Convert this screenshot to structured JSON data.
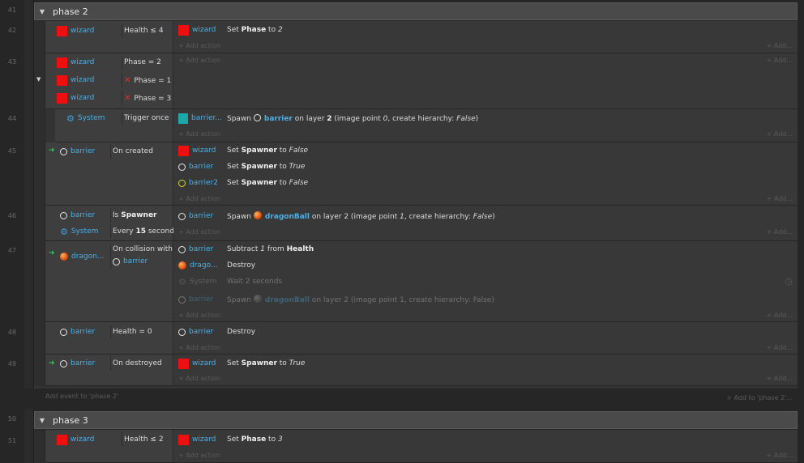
{
  "groups": [
    {
      "line": "41",
      "name": "phase 2"
    },
    {
      "line": "50",
      "name": "phase 3"
    }
  ],
  "lines": [
    "42",
    "43",
    "44",
    "45",
    "46",
    "47",
    "48",
    "49",
    "51"
  ],
  "add_action": "+ Add action",
  "add_right": "+ Add...",
  "add_event": "Add event to 'phase 2'",
  "add_to": "+ Add to 'phase 2'...",
  "ev42": {
    "cond_obj": "wizard",
    "cond_text": "Health ≤ 4",
    "act_obj": "wizard",
    "act_pre": "Set ",
    "act_bold": "Phase",
    "act_mid": " to ",
    "act_it": "2"
  },
  "ev43": {
    "c1_obj": "wizard",
    "c1_txt": "Phase = 2",
    "c2_obj": "wizard",
    "c2_txt": "Phase = 1",
    "c3_obj": "wizard",
    "c3_txt": "Phase = 3"
  },
  "ev44": {
    "cond_obj": "System",
    "cond_text": "Trigger once",
    "act_obj": "barrier...",
    "a_pre": "Spawn ",
    "a_name": "barrier",
    "a_post": " on layer ",
    "a_layer": "2",
    "a_post2": " (image point ",
    "a_pt": "0",
    "a_post3": ", create hierarchy: ",
    "a_false": "False",
    "a_end": ")"
  },
  "ev45": {
    "cond_obj": "barrier",
    "cond_text": "On created",
    "a1_obj": "wizard",
    "a1_txt": "Set ",
    "a1_b": "Spawner",
    "a1_m": " to ",
    "a1_i": "False",
    "a2_obj": "barrier",
    "a2_i": "True",
    "a3_obj": "barrier2",
    "a3_i": "False"
  },
  "ev46": {
    "c1_obj": "barrier",
    "c1_pre": "Is ",
    "c1_b": "Spawner",
    "c2_obj": "System",
    "c2_pre": "Every ",
    "c2_b": "15",
    "c2_post": " seconds",
    "act_obj": "barrier",
    "a_pre": "Spawn ",
    "a_name": "dragonBall",
    "a_post": " on layer 2 (image point ",
    "a_pt": "1",
    "a_post2": ", create hierarchy: ",
    "a_false": "False",
    "a_end": ")"
  },
  "ev47": {
    "cond_obj": "dragon...",
    "cond_text1": "On collision with",
    "cond_text2": "barrier",
    "a1_obj": "barrier",
    "a1_pre": "Subtract ",
    "a1_i": "1",
    "a1_m": " from ",
    "a1_b": "Health",
    "a2_obj": "drago...",
    "a2_txt": "Destroy",
    "a3_obj": "System",
    "a3_txt": "Wait 2 seconds",
    "a4_obj": "barrier",
    "a4_pre": "Spawn ",
    "a4_name": "dragonBall",
    "a4_post": " on layer 2 (image point 1, create hierarchy: False)"
  },
  "ev48": {
    "cond_obj": "barrier",
    "cond_text": "Health = 0",
    "act_obj": "barrier",
    "act_txt": "Destroy"
  },
  "ev49": {
    "cond_obj": "barrier",
    "cond_text": "On destroyed",
    "act_obj": "wizard",
    "act_pre": "Set ",
    "act_bold": "Spawner",
    "act_mid": " to ",
    "act_it": "True"
  },
  "ev51": {
    "cond_obj": "wizard",
    "cond_text": "Health ≤ 2",
    "act_obj": "wizard",
    "act_pre": "Set ",
    "act_bold": "Phase",
    "act_mid": " to ",
    "act_it": "3"
  }
}
